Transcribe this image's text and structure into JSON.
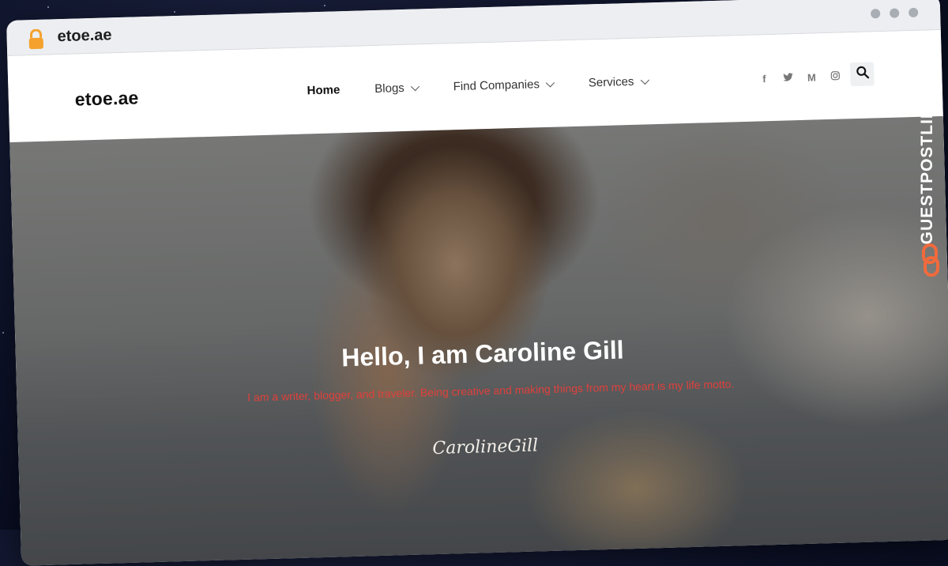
{
  "browser": {
    "url": "etoe.ae"
  },
  "site": {
    "logo": "etoe.ae",
    "nav": [
      {
        "label": "Home",
        "active": true
      },
      {
        "label": "Blogs",
        "dropdown": true
      },
      {
        "label": "Find Companies",
        "dropdown": true
      },
      {
        "label": "Services",
        "dropdown": true
      }
    ],
    "social": {
      "facebook": "f",
      "medium": "M"
    }
  },
  "hero": {
    "title": "Hello, I am Caroline Gill",
    "subtitle": "I am a writer, blogger, and traveler. Being creative and making things from my heart is my life motto.",
    "signature": "CarolineGill"
  },
  "badge": {
    "text": "GUESTPOSTLINKS",
    "accent": "#f26a3b"
  },
  "colors": {
    "subtitle": "#e0413c",
    "lock": "#f4a22d"
  }
}
